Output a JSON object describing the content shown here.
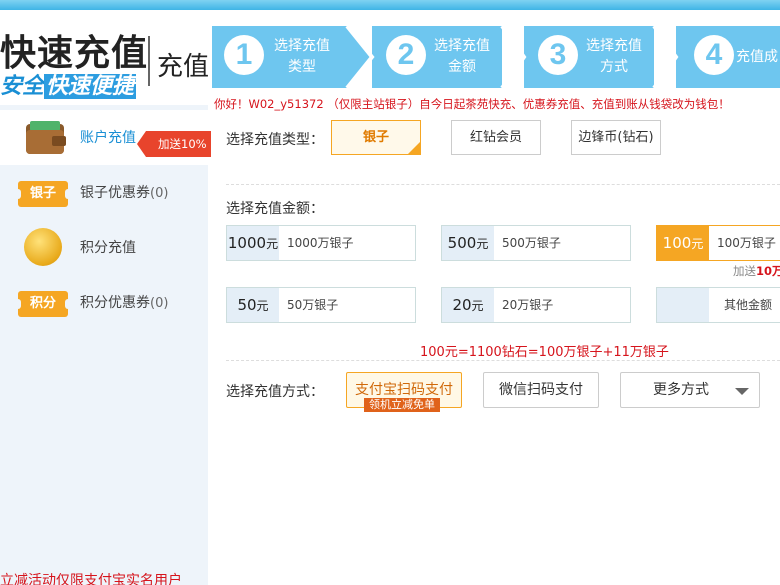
{
  "header": {
    "brand_title": "快速充值",
    "brand_slogan_part1": "安全",
    "brand_slogan_part2": "快速便捷",
    "brand_sub": "充值",
    "steps": [
      {
        "num": "1",
        "label_line1": "选择充值",
        "label_line2": "类型"
      },
      {
        "num": "2",
        "label_line1": "选择充值",
        "label_line2": "金额"
      },
      {
        "num": "3",
        "label_line1": "选择充值",
        "label_line2": "方式"
      },
      {
        "num": "4",
        "label_line1": "充值成",
        "label_line2": ""
      }
    ],
    "notice": "你好！W02_y51372 （仅限主站银子）自今日起茶苑快充、优惠券充值、充值到账从钱袋改为钱包！"
  },
  "sidebar": {
    "items": [
      {
        "label": "账户充值",
        "count": "",
        "icon": "wallet-icon"
      },
      {
        "label": "银子优惠券",
        "count": "(0)",
        "icon_text": "银子"
      },
      {
        "label": "积分充值",
        "count": "",
        "icon": "coin-icon"
      },
      {
        "label": "积分优惠券",
        "count": "(0)",
        "icon_text": "积分"
      }
    ],
    "badge": "加送10%",
    "footer": "立减活动仅限支付宝实名用户"
  },
  "main": {
    "type_label": "选择充值类型：",
    "types": [
      "银子",
      "红钻会员",
      "边锋币(钻石)"
    ],
    "amount_label": "选择充值金额：",
    "amounts": [
      {
        "price": "1000",
        "unit": "元",
        "desc": "1000万银子"
      },
      {
        "price": "500",
        "unit": "元",
        "desc": "500万银子"
      },
      {
        "price": "100",
        "unit": "元",
        "desc": "100万银子"
      },
      {
        "price": "50",
        "unit": "元",
        "desc": "50万银子"
      },
      {
        "price": "20",
        "unit": "元",
        "desc": "20万银子"
      },
      {
        "price": "",
        "unit": "",
        "desc": "其他金额"
      }
    ],
    "bonus_prefix": "加送",
    "bonus_value": "10万",
    "rate_text": "100元=1100钻石=100万银子+11万银子",
    "pay_label": "选择充值方式：",
    "pay_methods": [
      "支付宝扫码支付",
      "微信扫码支付",
      "更多方式"
    ],
    "pay_promo": "领机立减免单"
  },
  "colors": {
    "accent_blue": "#6ec6ef",
    "accent_orange": "#f5a623",
    "alert_red": "#d6141c"
  }
}
